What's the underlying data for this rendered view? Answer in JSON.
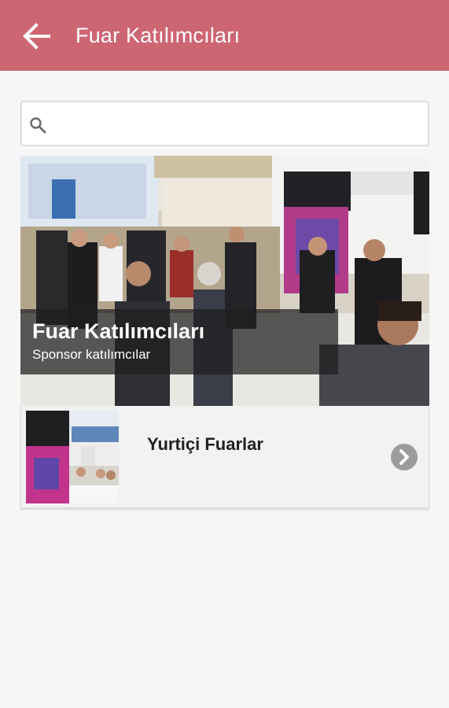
{
  "appbar": {
    "title": "Fuar Katılımcıları",
    "back_icon": "arrow-left-icon",
    "color": "#cd6673"
  },
  "search": {
    "placeholder": "",
    "value": "",
    "icon": "search-icon"
  },
  "hero": {
    "title": "Fuar Katılımcıları",
    "subtitle": "Sponsor katılımcılar"
  },
  "list": [
    {
      "label": "Yurtiçi Fuarlar",
      "icon": "chevron-right-icon"
    }
  ]
}
